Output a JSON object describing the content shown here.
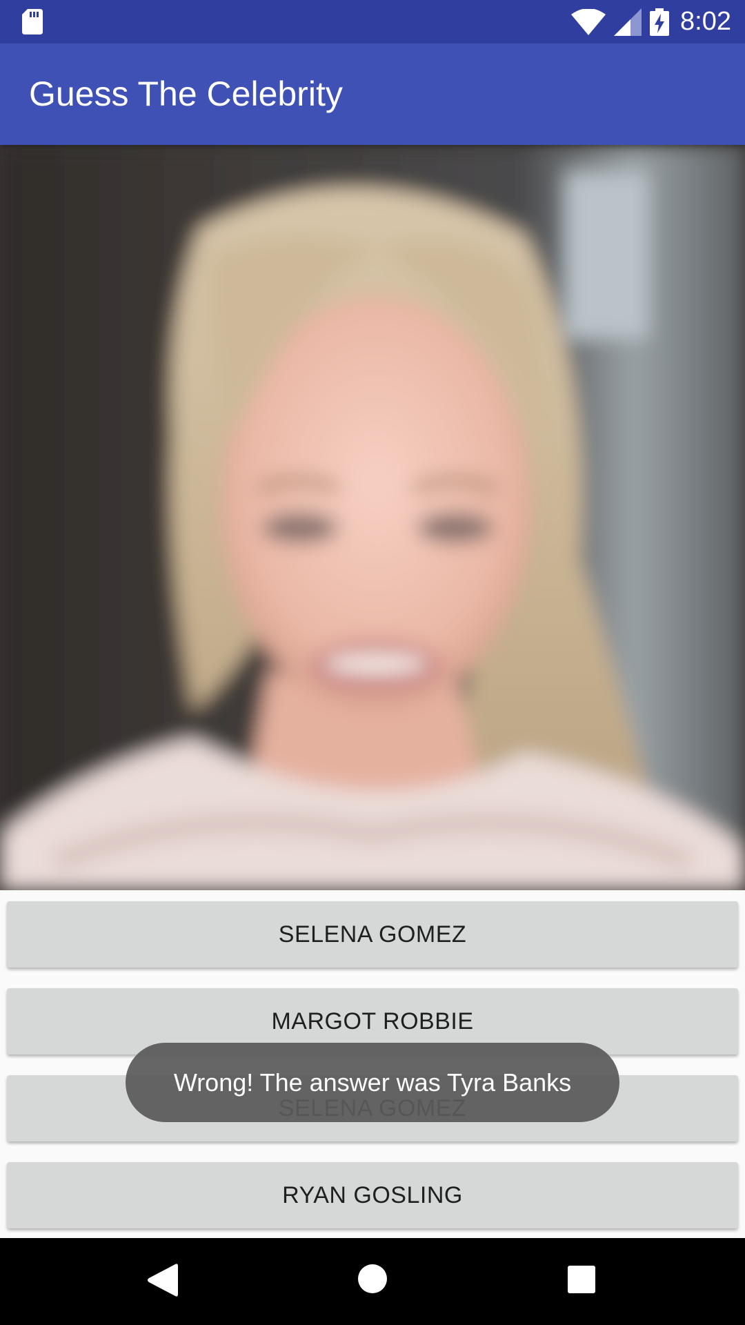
{
  "status_bar": {
    "time": "8:02",
    "icons": [
      "sd-card-icon",
      "wifi-icon",
      "signal-icon",
      "battery-charging-icon"
    ]
  },
  "app_bar": {
    "title": "Guess The Celebrity"
  },
  "image": {
    "semantic": "celebrity-photo"
  },
  "answers": [
    {
      "label": "SELENA GOMEZ"
    },
    {
      "label": "MARGOT ROBBIE"
    },
    {
      "label": "SELENA GOMEZ"
    },
    {
      "label": "RYAN GOSLING"
    }
  ],
  "toast": {
    "message": "Wrong! The answer was Tyra Banks"
  },
  "nav_bar": {
    "icons": [
      "back-icon",
      "home-icon",
      "recents-icon"
    ]
  },
  "colors": {
    "status_bar": "#303f9f",
    "app_bar": "#3f51b5",
    "button": "#d6d7d7",
    "toast": "#5a5a5a",
    "nav_bar": "#000000"
  }
}
